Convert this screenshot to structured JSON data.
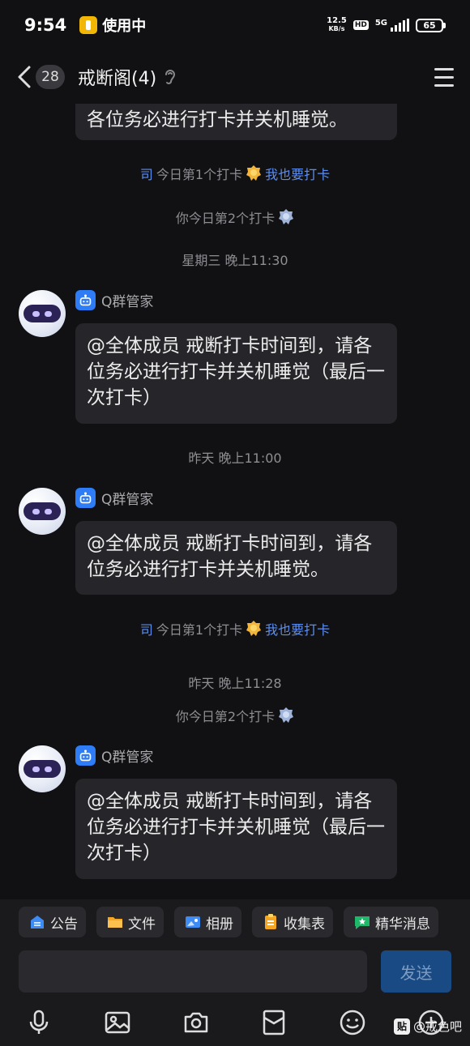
{
  "status_bar": {
    "time": "9:54",
    "in_use_label": "使用中",
    "net_speed_value": "12.5",
    "net_speed_unit": "KB/s",
    "hd": "HD",
    "signal": "5G",
    "battery": "65"
  },
  "header": {
    "unread_count": "28",
    "title": "戒断阁(4)"
  },
  "chat": {
    "partial_message": "各位务必进行打卡并关机睡觉。",
    "sys_1_sender": "司",
    "sys_1_text": "今日第1个打卡",
    "sys_1_action": "我也要打卡",
    "sys_2_text": "你今日第2个打卡",
    "time_1": "星期三 晚上11:30",
    "sender_1": "Q群管家",
    "msg_1": "@全体成员 戒断打卡时间到，请各位务必进行打卡并关机睡觉（最后一次打卡）",
    "time_2": "昨天 晚上11:00",
    "sender_2": "Q群管家",
    "msg_2": "@全体成员 戒断打卡时间到，请各位务必进行打卡并关机睡觉。",
    "sys_3_sender": "司",
    "sys_3_text": "今日第1个打卡",
    "sys_3_action": "我也要打卡",
    "time_3": "昨天 晚上11:28",
    "sys_4_text": "你今日第2个打卡",
    "sender_3": "Q群管家",
    "msg_3": "@全体成员 戒断打卡时间到，请各位务必进行打卡并关机睡觉（最后一次打卡）"
  },
  "quick_bar": [
    {
      "label": "公告",
      "icon": "announcement-icon"
    },
    {
      "label": "文件",
      "icon": "folder-icon"
    },
    {
      "label": "相册",
      "icon": "album-icon"
    },
    {
      "label": "收集表",
      "icon": "form-icon"
    },
    {
      "label": "精华消息",
      "icon": "highlight-icon"
    }
  ],
  "input": {
    "value": "",
    "send_label": "发送"
  },
  "watermark": {
    "logo": "贴",
    "text": "@戒色吧"
  },
  "colors": {
    "background": "#111113",
    "bubble": "#26262a",
    "accent_blue": "#2e7df6",
    "link_blue": "#5b8ef2",
    "send_button": "#1a4a83"
  }
}
